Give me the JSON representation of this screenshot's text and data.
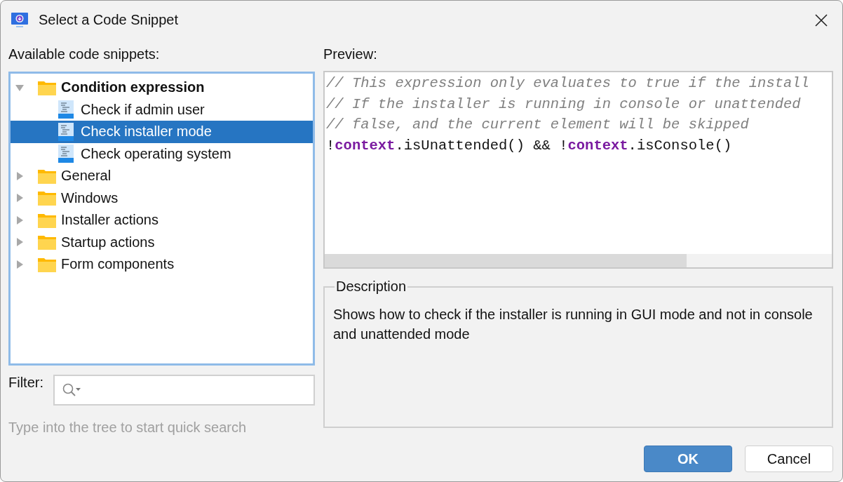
{
  "window": {
    "title": "Select a Code Snippet"
  },
  "tree": {
    "label": "Available code snippets:",
    "items": [
      {
        "kind": "folder",
        "label": "Condition expression",
        "expanded": true,
        "selected": false,
        "children": [
          {
            "kind": "snippet",
            "label": "Check if admin user",
            "selected": false
          },
          {
            "kind": "snippet",
            "label": "Check installer mode",
            "selected": true
          },
          {
            "kind": "snippet",
            "label": "Check operating system",
            "selected": false
          }
        ]
      },
      {
        "kind": "folder",
        "label": "General",
        "expanded": false,
        "selected": false
      },
      {
        "kind": "folder",
        "label": "Windows",
        "expanded": false,
        "selected": false
      },
      {
        "kind": "folder",
        "label": "Installer actions",
        "expanded": false,
        "selected": false
      },
      {
        "kind": "folder",
        "label": "Startup actions",
        "expanded": false,
        "selected": false
      },
      {
        "kind": "folder",
        "label": "Form components",
        "expanded": false,
        "selected": false
      }
    ]
  },
  "filter": {
    "label": "Filter:",
    "hint": "Type into the tree to start quick search"
  },
  "preview": {
    "label": "Preview:",
    "lines": [
      [
        {
          "kind": "comment",
          "text": "// This expression only evaluates to true if the install"
        }
      ],
      [
        {
          "kind": "comment",
          "text": "// If the installer is running in console or unattended"
        }
      ],
      [
        {
          "kind": "comment",
          "text": "// false, and the current element will be skipped"
        }
      ],
      [
        {
          "kind": "plain",
          "text": "!"
        },
        {
          "kind": "keyword",
          "text": "context"
        },
        {
          "kind": "plain",
          "text": ".isUnattended() && !"
        },
        {
          "kind": "keyword",
          "text": "context"
        },
        {
          "kind": "plain",
          "text": ".isConsole()"
        }
      ]
    ]
  },
  "description": {
    "label": "Description",
    "text": "Shows how to check if the installer is running in GUI mode and not in console and unattended mode"
  },
  "buttons": [
    {
      "label": "OK",
      "kind": "primary"
    },
    {
      "label": "Cancel",
      "kind": "secondary"
    }
  ]
}
